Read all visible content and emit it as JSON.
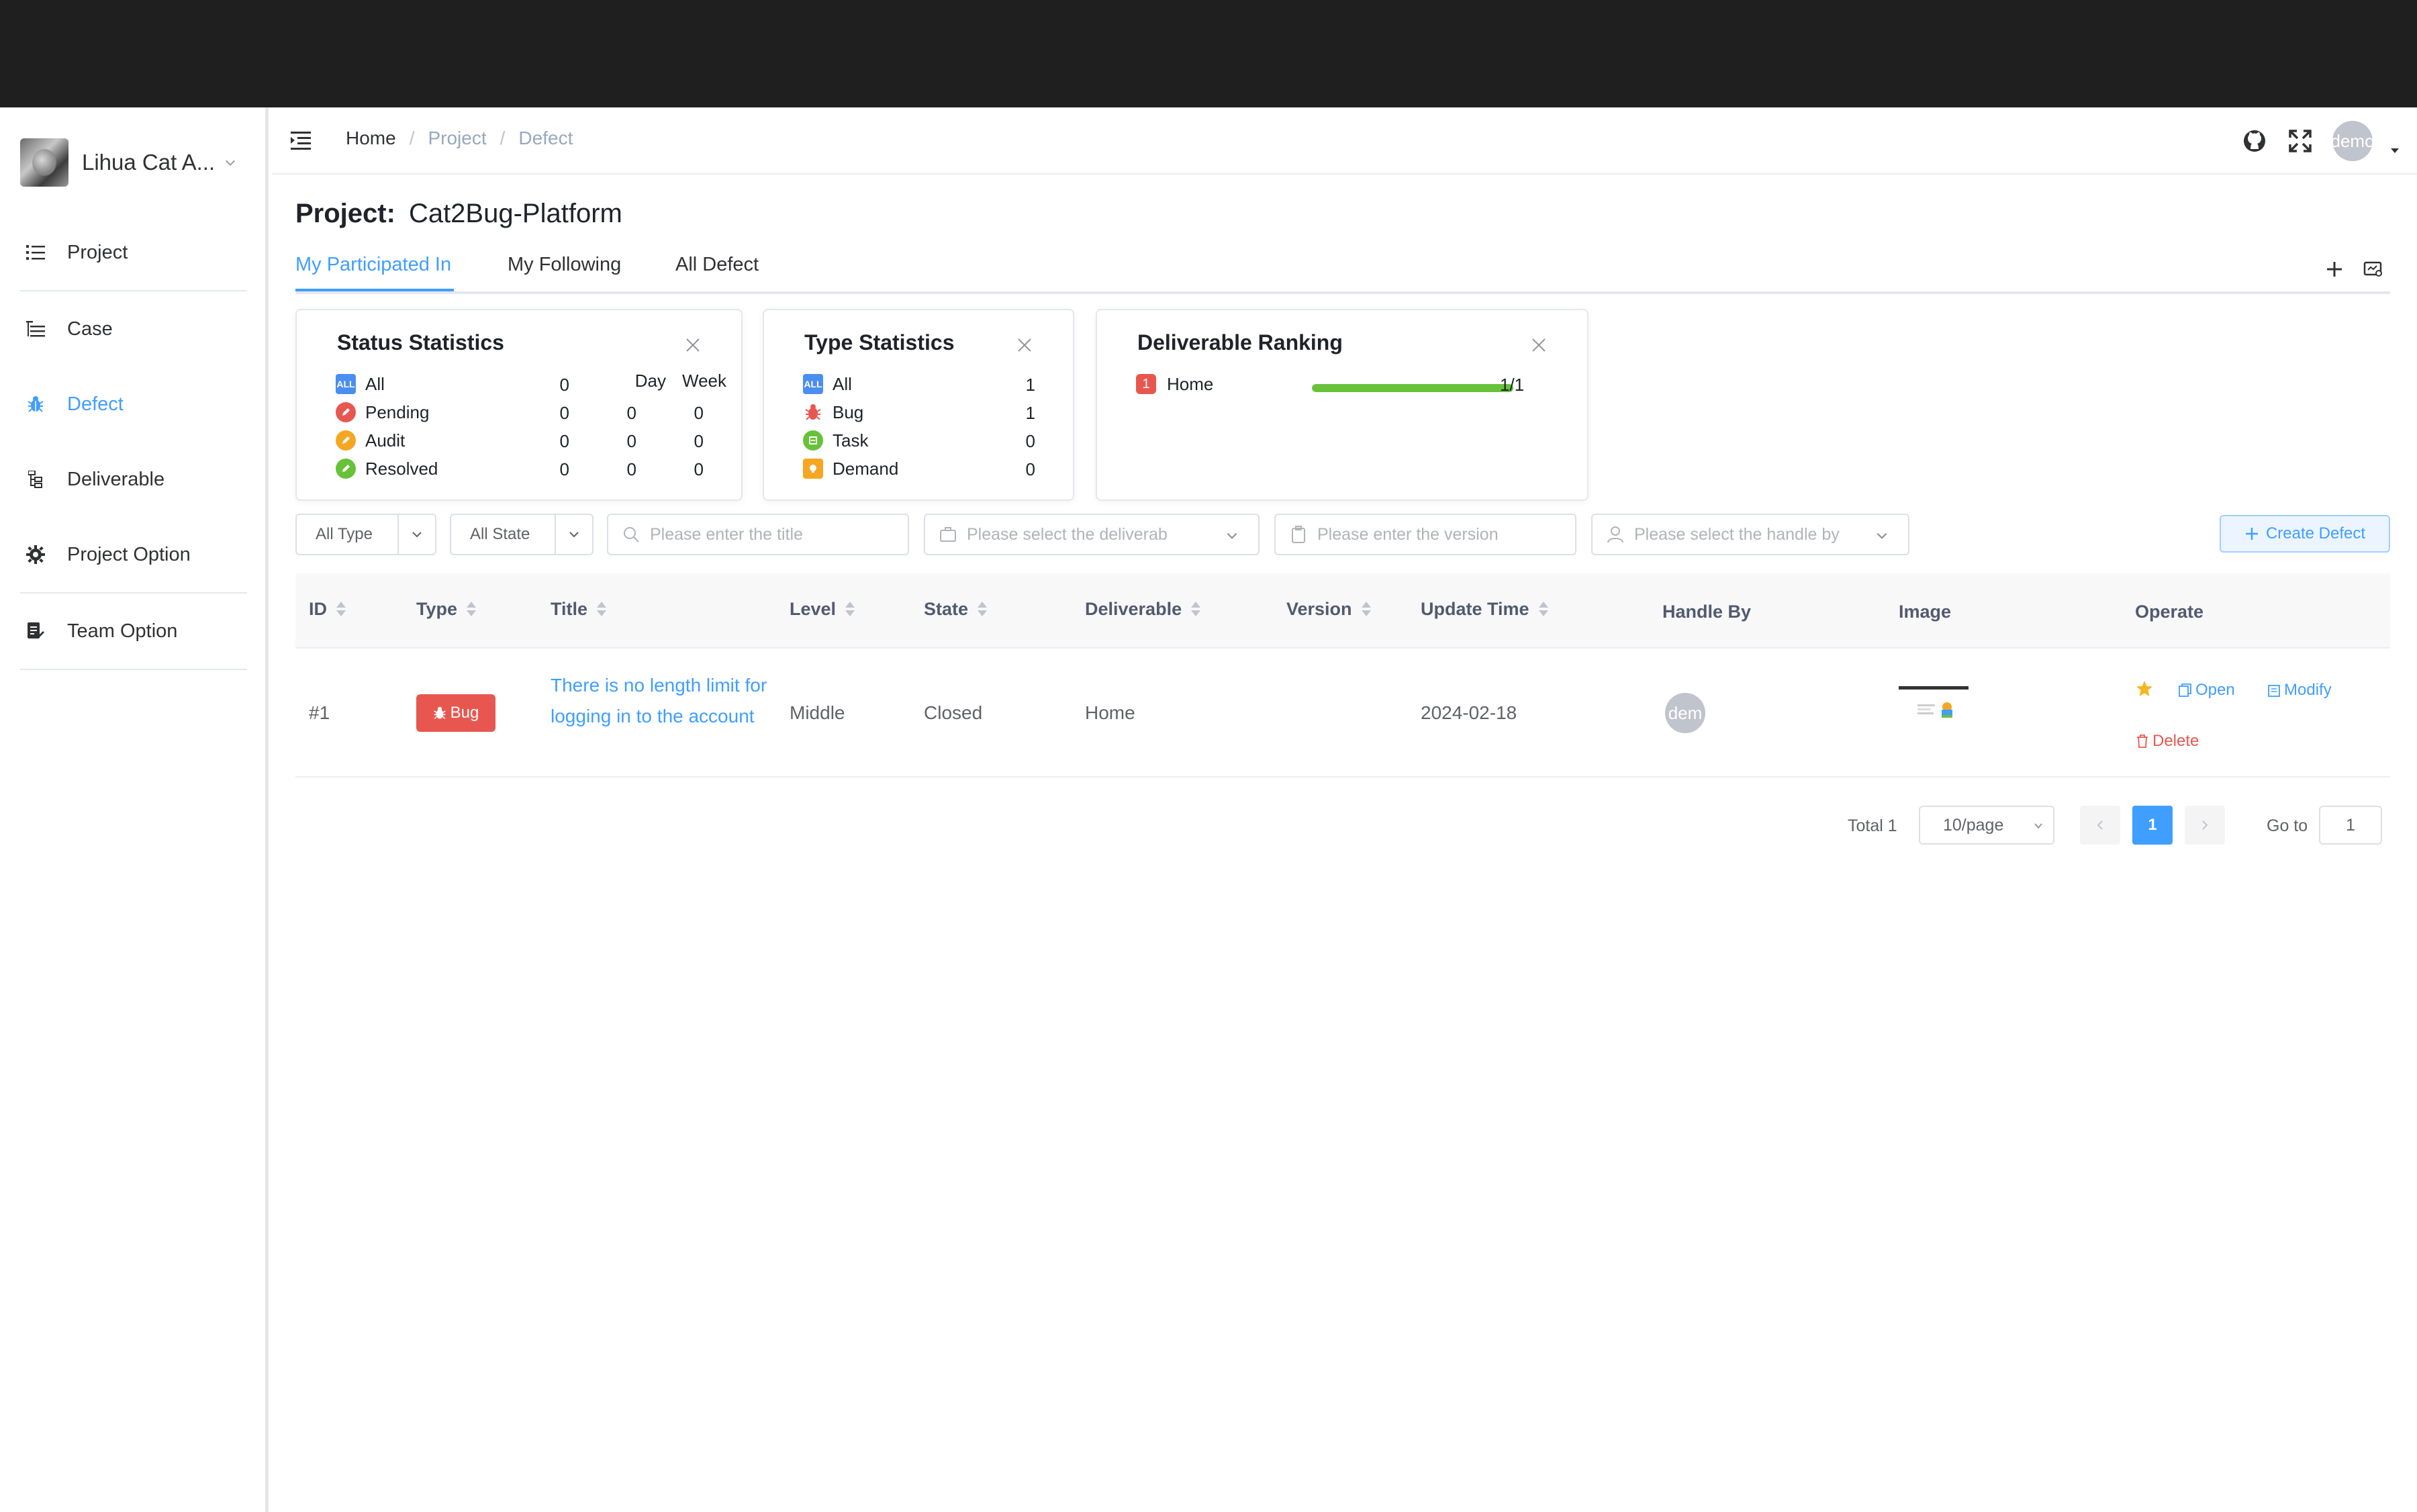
{
  "sidebar": {
    "team_name": "Lihua Cat A...",
    "items": [
      {
        "label": "Project",
        "icon": "list-icon"
      },
      {
        "label": "Case",
        "icon": "tree-list-icon"
      },
      {
        "label": "Defect",
        "icon": "bug-icon"
      },
      {
        "label": "Deliverable",
        "icon": "tree-icon"
      },
      {
        "label": "Project Option",
        "icon": "gear-icon"
      },
      {
        "label": "Team Option",
        "icon": "document-edit-icon"
      }
    ],
    "active": "Defect"
  },
  "header": {
    "breadcrumbs": [
      "Home",
      "Project",
      "Defect"
    ],
    "avatar_text": "demo"
  },
  "main": {
    "project_label": "Project:",
    "project_name": "Cat2Bug-Platform",
    "tabs": [
      "My Participated In",
      "My Following",
      "All Defect"
    ],
    "active_tab": "My Participated In"
  },
  "status_stats": {
    "title": "Status Statistics",
    "col_day": "Day",
    "col_week": "Week",
    "rows": [
      {
        "label": "All",
        "total": "0",
        "day": "",
        "week": "",
        "color": "#4a8ef0"
      },
      {
        "label": "Pending",
        "total": "0",
        "day": "0",
        "week": "0",
        "color": "#e8574f"
      },
      {
        "label": "Audit",
        "total": "0",
        "day": "0",
        "week": "0",
        "color": "#f5a623"
      },
      {
        "label": "Resolved",
        "total": "0",
        "day": "0",
        "week": "0",
        "color": "#67c23a"
      }
    ],
    "all_icon_text": "ALL"
  },
  "type_stats": {
    "title": "Type Statistics",
    "rows": [
      {
        "label": "All",
        "total": "1",
        "color": "#4a8ef0"
      },
      {
        "label": "Bug",
        "total": "1",
        "color": "#e8574f"
      },
      {
        "label": "Task",
        "total": "0",
        "color": "#67c23a"
      },
      {
        "label": "Demand",
        "total": "0",
        "color": "#f5a623"
      }
    ],
    "all_icon_text": "ALL"
  },
  "deliverable_ranking": {
    "title": "Deliverable Ranking",
    "rows": [
      {
        "rank": "1",
        "name": "Home",
        "ratio": "1/1",
        "progress": 1.0
      }
    ]
  },
  "filters": {
    "type": "All Type",
    "state": "All State",
    "title_placeholder": "Please enter the title",
    "deliverable_placeholder": "Please select the deliverab",
    "version_placeholder": "Please enter the version",
    "handle_placeholder": "Please select the handle by",
    "create_label": "Create Defect"
  },
  "table": {
    "headers": [
      "ID",
      "Type",
      "Title",
      "Level",
      "State",
      "Deliverable",
      "Version",
      "Update Time",
      "Handle By",
      "Image",
      "Operate"
    ],
    "rows": [
      {
        "id": "#1",
        "type": "Bug",
        "title": "There is no length limit for logging in to the account",
        "level": "Middle",
        "state": "Closed",
        "deliverable": "Home",
        "version": "",
        "update_time": "2024-02-18",
        "handle_by": "dem",
        "ops": {
          "open": "Open",
          "modify": "Modify",
          "delete": "Delete"
        }
      }
    ]
  },
  "pagination": {
    "total": "Total 1",
    "page_size": "10/page",
    "current": "1",
    "goto_label": "Go to",
    "goto_value": "1"
  },
  "colors": {
    "primary": "#409eff",
    "danger": "#e8574f",
    "success": "#67c23a",
    "warning": "#f5a623"
  }
}
